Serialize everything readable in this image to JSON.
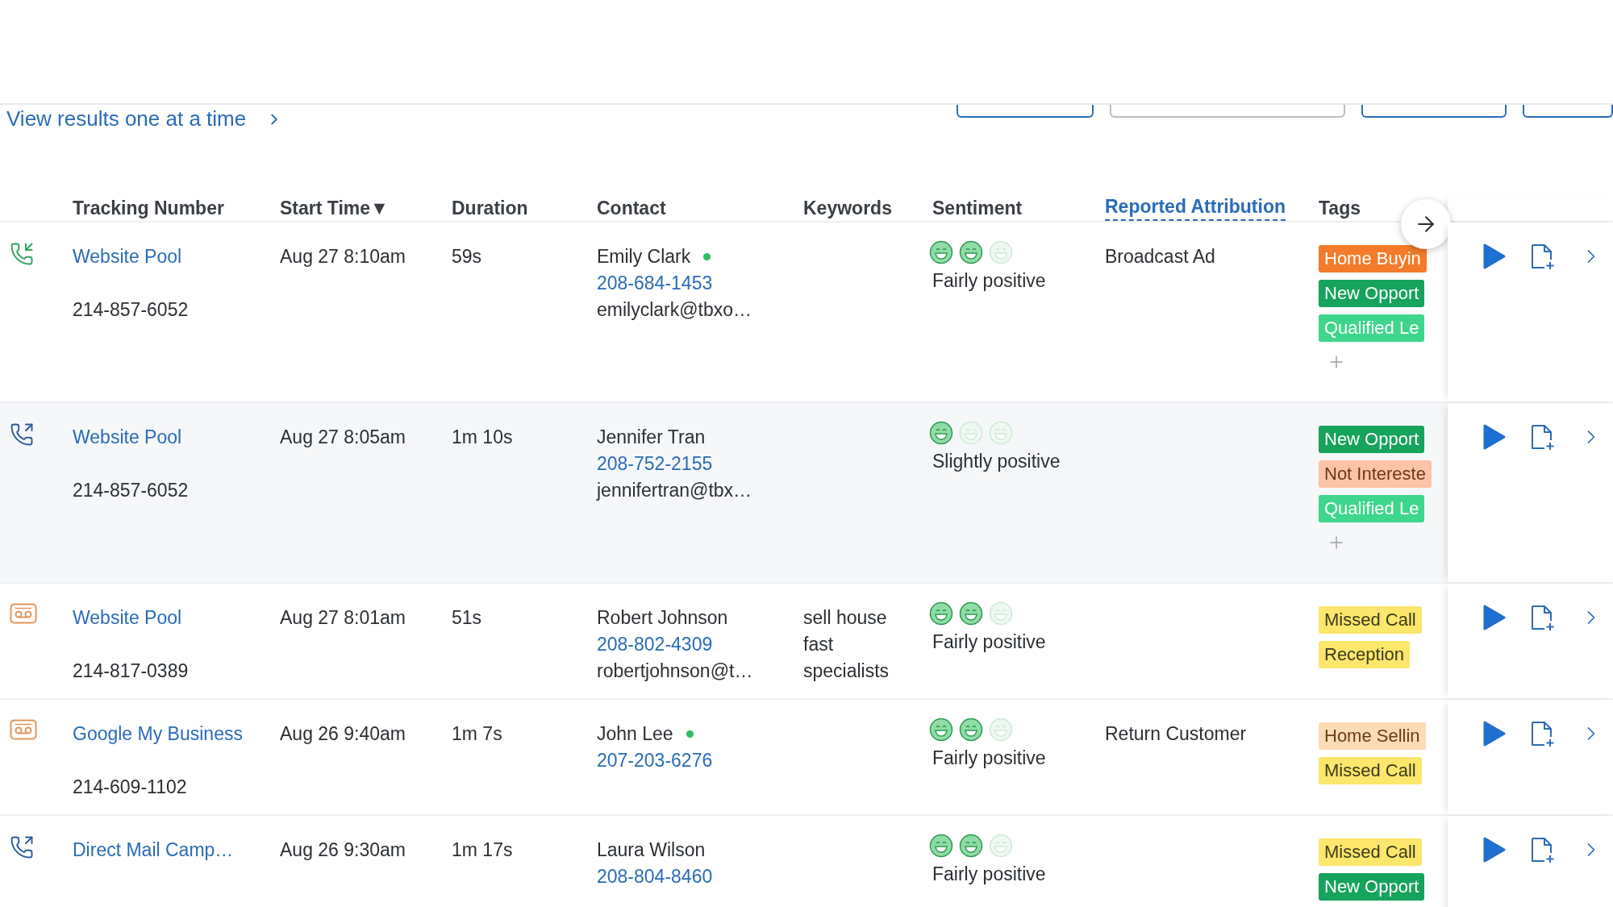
{
  "toolbar": {
    "link": "View results one at a time"
  },
  "columns": [
    {
      "label": "Tracking Number",
      "active": false
    },
    {
      "label": "Start Time▼",
      "active": false
    },
    {
      "label": "Duration",
      "active": false
    },
    {
      "label": "Contact",
      "active": false
    },
    {
      "label": "Keywords",
      "active": false
    },
    {
      "label": "Sentiment",
      "active": false
    },
    {
      "label": "Reported Attribution",
      "active": true
    },
    {
      "label": "Tags",
      "active": false
    }
  ],
  "rows": [
    {
      "kind": "inbound",
      "source": "Website Pool",
      "number": "214-857-6052",
      "start": "Aug 27 8:10am",
      "duration": "59s",
      "contact": {
        "name": "Emily Clark",
        "online": true,
        "phone": "208-684-1453",
        "email": "emilyclark@tbxo…"
      },
      "stars": 2,
      "sentiment": "Fairly positive",
      "attribution": "Broadcast Ad",
      "tags": [
        {
          "label": "Home Buyin",
          "color": "#f47b2a"
        },
        {
          "label": "New Opport",
          "color": "#16a35b"
        },
        {
          "label": "Qualified Le",
          "color": "#3ed68c"
        }
      ],
      "can_add_tag": true,
      "shaded": false
    },
    {
      "kind": "outbound",
      "source": "Website Pool",
      "number": "214-857-6052",
      "start": "Aug 27 8:05am",
      "duration": "1m 10s",
      "contact": {
        "name": "Jennifer Tran",
        "online": false,
        "phone": "208-752-2155",
        "email": "jennifertran@tbx…"
      },
      "stars": 1,
      "sentiment": "Slightly positive",
      "tags": [
        {
          "label": "New Opport",
          "color": "#16a35b"
        },
        {
          "label": "Not Intereste",
          "color": "#fcc3a7"
        },
        {
          "label": "Qualified Le",
          "color": "#3ed68c"
        }
      ],
      "can_add_tag": true,
      "shaded": true
    },
    {
      "kind": "voicemail",
      "source": "Website Pool",
      "number": "214-817-0389",
      "start": "Aug 27 8:01am",
      "duration": "51s",
      "contact": {
        "name": "Robert Johnson",
        "online": false,
        "phone": "208-802-4309",
        "email": "robertjohnson@t…"
      },
      "keywords": "sell house fast specialists",
      "stars": 2,
      "sentiment": "Fairly positive",
      "tags": [
        {
          "label": "Missed Call",
          "color": "#fce66b"
        },
        {
          "label": "Reception",
          "color": "#fce66b"
        }
      ],
      "can_add_tag": false,
      "shaded": false
    },
    {
      "kind": "voicemail",
      "source": "Google My Business",
      "number": "214-609-1102",
      "start": "Aug 26 9:40am",
      "duration": "1m 7s",
      "contact": {
        "name": "John Lee",
        "online": true,
        "phone": "207-203-6276"
      },
      "stars": 2,
      "sentiment": "Fairly positive",
      "attribution": "Return Customer",
      "tags": [
        {
          "label": "Home Sellin",
          "color": "#fddbb5"
        },
        {
          "label": "Missed Call",
          "color": "#fce66b"
        }
      ],
      "can_add_tag": false,
      "shaded": false
    },
    {
      "kind": "outbound",
      "source": "Direct Mail Camp…",
      "start": "Aug 26 9:30am",
      "duration": "1m 17s",
      "contact": {
        "name": "Laura Wilson",
        "online": false,
        "phone": "208-804-8460"
      },
      "stars": 2,
      "sentiment": "Fairly positive",
      "tags": [
        {
          "label": "Missed Call",
          "color": "#fce66b"
        },
        {
          "label": "New Opport",
          "color": "#16a35b"
        }
      ],
      "can_add_tag": false,
      "shaded": false
    }
  ]
}
